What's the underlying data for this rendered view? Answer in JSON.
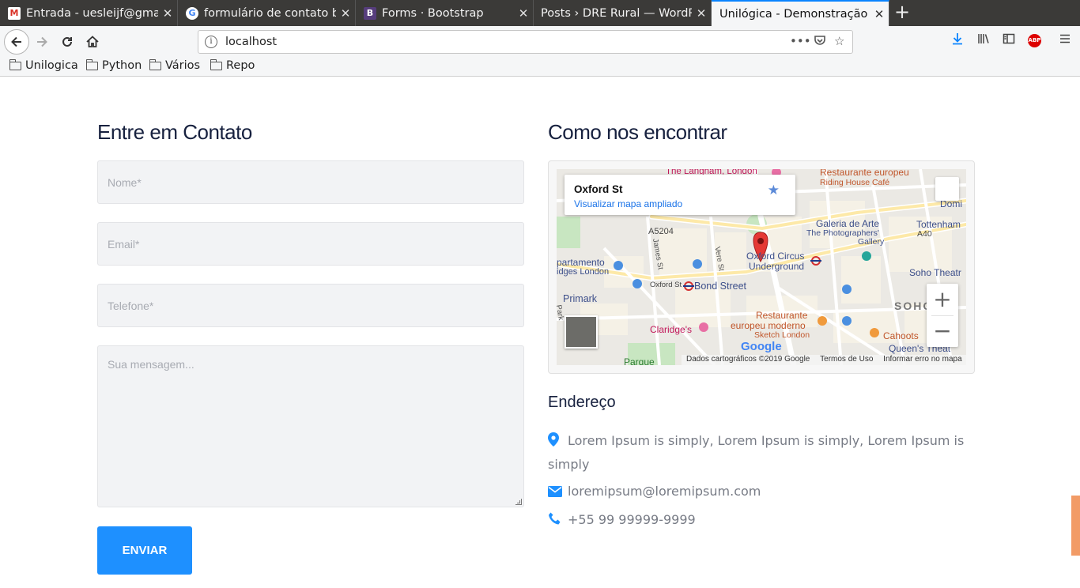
{
  "browser": {
    "tabs": [
      {
        "title": "Entrada - uesleijf@gmail.com",
        "favicon": "gmail-icon",
        "active": false
      },
      {
        "title": "formulário de contato bootstrap",
        "favicon": "google-icon",
        "active": false
      },
      {
        "title": "Forms · Bootstrap",
        "favicon": "bootstrap-icon",
        "active": false
      },
      {
        "title": "Posts › DRE Rural — WordPress",
        "favicon": "none",
        "active": false
      },
      {
        "title": "Unilógica - Demonstração",
        "favicon": "none",
        "active": true
      }
    ],
    "url": "localhost",
    "bookmarks": [
      "Unilogica",
      "Python",
      "Vários",
      "Repo"
    ]
  },
  "contact": {
    "heading": "Entre em Contato",
    "placeholders": {
      "name": "Nome*",
      "email": "Email*",
      "phone": "Telefone*",
      "message": "Sua mensagem..."
    },
    "submit_label": "ENVIAR"
  },
  "find_us": {
    "heading": "Como nos encontrar",
    "map": {
      "place_title": "Oxford St",
      "enlarge_link": "Visualizar mapa ampliado",
      "labels": {
        "langham": "The Langham, London",
        "rest_top": "Restaurante europeu",
        "riding": "Riding House Café",
        "domino": "Domi",
        "a5204": "A5204",
        "galeria": "Galeria de Arte",
        "photographers": "The Photographers'",
        "gallery": "Gallery",
        "tottenham": "Tottenham",
        "a40": "A40",
        "apartamento": "partamento",
        "bridges": "idges London",
        "james": "James St",
        "vere": "Vere St",
        "oxford_circus_1": "Oxford Circus",
        "oxford_circus_2": "Underground",
        "soho_theatre": "Soho Theatr",
        "oxford_st": "Oxford St",
        "bond_street": "Bond Street",
        "primark": "Primark",
        "soho": "SOHO",
        "claridges": "Claridge's",
        "rest_mid_1": "Restaurante",
        "rest_mid_2": "europeu moderno",
        "sketch": "Sketch London",
        "cahoots": "Cahoots",
        "queens": "Queen's Theat",
        "park": "Park",
        "parque": "Parque",
        "google": "Google",
        "attribution": "Dados cartográficos ©2019 Google",
        "terms": "Termos de Uso",
        "report": "Informar erro no mapa"
      }
    },
    "address_heading": "Endereço",
    "address": "Lorem Ipsum is simply, Lorem Ipsum is simply, Lorem Ipsum is simply",
    "email": "loremipsum@loremipsum.com",
    "phone": "+55 99 99999-9999"
  },
  "colors": {
    "accent": "#1e90ff",
    "heading": "#17213f",
    "text": "#777b85"
  }
}
